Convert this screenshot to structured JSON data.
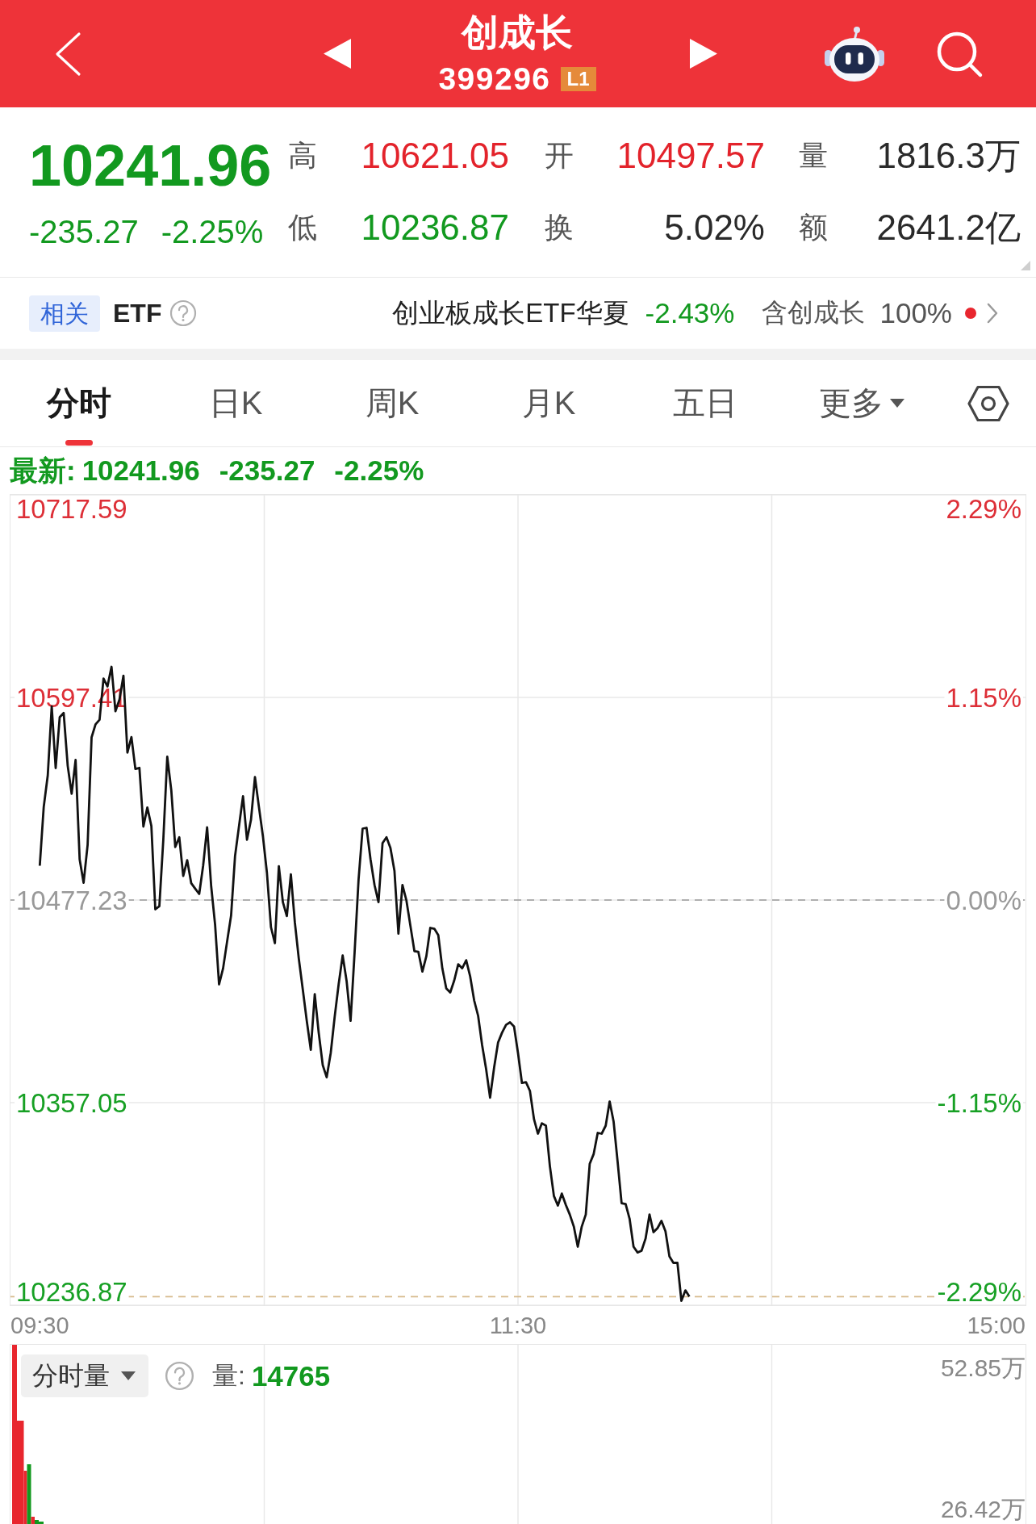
{
  "header": {
    "title": "创成长",
    "code": "399296",
    "badge": "L1"
  },
  "quote": {
    "price": "10241.96",
    "change": "-235.27",
    "change_pct": "-2.25%",
    "falling": true,
    "stats": [
      {
        "label": "高",
        "value": "10621.05",
        "color": "#e3232b"
      },
      {
        "label": "开",
        "value": "10497.57",
        "color": "#e3232b"
      },
      {
        "label": "量",
        "value": "1816.3万",
        "color": "#2a2a2a"
      },
      {
        "label": "低",
        "value": "10236.87",
        "color": "#12991f"
      },
      {
        "label": "换",
        "value": "5.02%",
        "color": "#2a2a2a"
      },
      {
        "label": "额",
        "value": "2641.2亿",
        "color": "#2a2a2a"
      }
    ]
  },
  "related_etf": {
    "tag": "相关",
    "label": "ETF",
    "fund_name": "创业板成长ETF华夏",
    "fund_change": "-2.43%",
    "fund_falling": true,
    "holding_label": "含创成长",
    "holding_pct": "100%",
    "notification_dot": true
  },
  "tabs": [
    {
      "label": "分时",
      "selected": true,
      "kind": "tab"
    },
    {
      "label": "日K",
      "selected": false,
      "kind": "tab"
    },
    {
      "label": "周K",
      "selected": false,
      "kind": "tab"
    },
    {
      "label": "月K",
      "selected": false,
      "kind": "tab"
    },
    {
      "label": "五日",
      "selected": false,
      "kind": "tab"
    },
    {
      "label": "更多",
      "selected": false,
      "kind": "dropdown"
    }
  ],
  "intraday_chart": {
    "latest": {
      "label": "最新:",
      "price": "10241.96",
      "change": "-235.27",
      "change_pct": "-2.25%",
      "falling": true
    },
    "chart_data": {
      "type": "line",
      "grid": true,
      "categories": [
        "09:30",
        null,
        null,
        null,
        null,
        null,
        null,
        null,
        null,
        null,
        null,
        null,
        null,
        null,
        null,
        null,
        null,
        null,
        null,
        null,
        null,
        null,
        null,
        null,
        null,
        null,
        null,
        null,
        null,
        null,
        null,
        null,
        null,
        null,
        null,
        null,
        null,
        null,
        null,
        null,
        null,
        null,
        null,
        null,
        null,
        null,
        null,
        null,
        null,
        null,
        null,
        null,
        null,
        null,
        null,
        null,
        null,
        null,
        null,
        null,
        null,
        null,
        null,
        null,
        null,
        null,
        null,
        null,
        null,
        null,
        null,
        null,
        null,
        null,
        null,
        null,
        null,
        null,
        null,
        null,
        null,
        null,
        null,
        null,
        null,
        null,
        null,
        null,
        null,
        null,
        null,
        null,
        null,
        null,
        null,
        null,
        null,
        null,
        null,
        null,
        null,
        null,
        null,
        null,
        null,
        null,
        null,
        null,
        null,
        null,
        null,
        null,
        null,
        null,
        null,
        null,
        null,
        null,
        null,
        null,
        "11:30",
        null,
        null,
        null,
        null,
        null,
        null,
        null,
        null,
        null,
        null,
        null,
        null,
        null,
        null,
        null,
        null,
        null,
        null,
        null,
        null,
        null,
        null,
        null,
        null,
        null,
        null,
        null,
        null,
        null,
        null,
        null,
        null,
        null,
        null,
        null,
        null,
        null,
        null,
        null,
        null,
        null,
        null,
        null,
        null,
        null,
        null,
        null,
        null,
        null,
        null,
        null,
        null,
        null,
        null,
        null,
        null,
        null,
        null,
        null,
        null,
        null,
        null,
        null,
        null,
        null,
        null,
        null,
        null,
        null,
        null,
        null,
        null,
        null,
        null,
        null,
        null,
        null,
        null,
        null,
        null,
        null,
        null,
        null,
        null,
        null,
        null,
        null,
        null,
        null,
        null,
        null,
        null,
        null,
        null,
        null,
        null,
        null,
        null,
        null,
        null,
        null,
        null,
        null,
        null,
        null,
        null,
        null,
        null,
        null,
        null,
        null,
        null,
        null,
        null,
        null,
        null,
        null,
        null,
        null,
        "15:00"
      ],
      "values": [
        10497.6,
        10532.5,
        10551.2,
        10592.1,
        10555.5,
        10585.7,
        10588.2,
        10556.9,
        10540.3,
        10560.3,
        10501.4,
        10487.5,
        10510.0,
        10573.7,
        10581.4,
        10584.2,
        10608.6,
        10603.9,
        10615.6,
        10589.2,
        10596.2,
        10610.3,
        10564.7,
        10573.9,
        10555.0,
        10555.6,
        10520.8,
        10532.1,
        10521.2,
        10471.7,
        10473.6,
        10513.0,
        10562.2,
        10542.3,
        10508.7,
        10514.5,
        10491.5,
        10500.9,
        10487.2,
        10484.0,
        10480.8,
        10497.7,
        10520.4,
        10485.6,
        10462.6,
        10427.2,
        10436.7,
        10452.4,
        10468.0,
        10503.3,
        10521.0,
        10538.8,
        10513.0,
        10524.9,
        10550.2,
        10532.5,
        10514.9,
        10493.5,
        10461.2,
        10451.6,
        10497.3,
        10476.0,
        10467.7,
        10492.5,
        10464.1,
        10442.6,
        10424.1,
        10405.6,
        10388.4,
        10421.4,
        10398.5,
        10379.3,
        10372.1,
        10386.5,
        10408.0,
        10427.2,
        10444.4,
        10429.1,
        10405.6,
        10446.3,
        10489.4,
        10519.6,
        10520.1,
        10501.4,
        10486.1,
        10476.0,
        10511.0,
        10514.5,
        10508.1,
        10494.4,
        10457.3,
        10486.2,
        10477.0,
        10462.1,
        10446.9,
        10446.5,
        10434.8,
        10443.9,
        10460.7,
        10460.2,
        10456.4,
        10436.7,
        10424.8,
        10422.4,
        10429.6,
        10439.1,
        10436.7,
        10441.5,
        10432.0,
        10417.6,
        10408.5,
        10391.3,
        10376.9,
        10360.0,
        10377.9,
        10392.7,
        10398.5,
        10403.2,
        10404.7,
        10402.2,
        10386.5,
        10368.7,
        10369.2,
        10364.0,
        10347.3,
        10338.6,
        10344.8,
        10343.4,
        10319.4,
        10301.7,
        10296.0,
        10303.1,
        10296.4,
        10290.7,
        10283.5,
        10271.6,
        10283.5,
        10290.7,
        10320.8,
        10326.6,
        10339.1,
        10338.6,
        10343.4,
        10357.7,
        10345.8,
        10321.8,
        10297.4,
        10296.9,
        10288.2,
        10271.6,
        10268.2,
        10269.2,
        10276.4,
        10290.7,
        10280.2,
        10282.6,
        10286.9,
        10280.7,
        10265.8,
        10262.0,
        10262.0,
        10239.5,
        10245.7,
        10242.0,
        null,
        null,
        null,
        null,
        null,
        null,
        null,
        null,
        null,
        null,
        null,
        null,
        null,
        null,
        null,
        null,
        null,
        null,
        null,
        null,
        null,
        null,
        null,
        null,
        null,
        null,
        null,
        null,
        null,
        null,
        null,
        null,
        null,
        null,
        null,
        null,
        null,
        null,
        null,
        null,
        null,
        null,
        null,
        null,
        null,
        null,
        null,
        null,
        null,
        null,
        null,
        null,
        null,
        null,
        null,
        null,
        null,
        null,
        null,
        null,
        null,
        null,
        null,
        null,
        null,
        null,
        null,
        null,
        null,
        null,
        null,
        null,
        null,
        null,
        null,
        null,
        null
      ],
      "ylim": [
        10236.87,
        10717.59
      ],
      "yticks": [
        {
          "value": 10717.59,
          "label": "10717.59"
        },
        {
          "value": 10597.41,
          "label": "10597.41"
        },
        {
          "value": 10477.23,
          "label": "10477.23"
        },
        {
          "value": 10357.05,
          "label": "10357.05"
        },
        {
          "value": 10236.87,
          "label": "10236.87"
        }
      ],
      "ref_lines": [
        {
          "axis": "y",
          "value": 10477.23,
          "color": "#9a9a9a"
        },
        {
          "axis": "y",
          "value": 10241.96,
          "color": "#d6b98a"
        }
      ]
    },
    "percent_labels": [
      {
        "label": "2.29%",
        "color": "#dd2f37"
      },
      {
        "label": "1.15%",
        "color": "#dd2f37"
      },
      {
        "label": "0.00%",
        "color": "#999999"
      },
      {
        "label": "-1.15%",
        "color": "#17a024"
      },
      {
        "label": "-2.29%",
        "color": "#17a024"
      }
    ]
  },
  "volume_chart": {
    "selector": "分时量",
    "value_label": "量:",
    "value": "14765",
    "value_falling": true,
    "max_label": "52.85万",
    "mid_label": "26.42万"
  }
}
